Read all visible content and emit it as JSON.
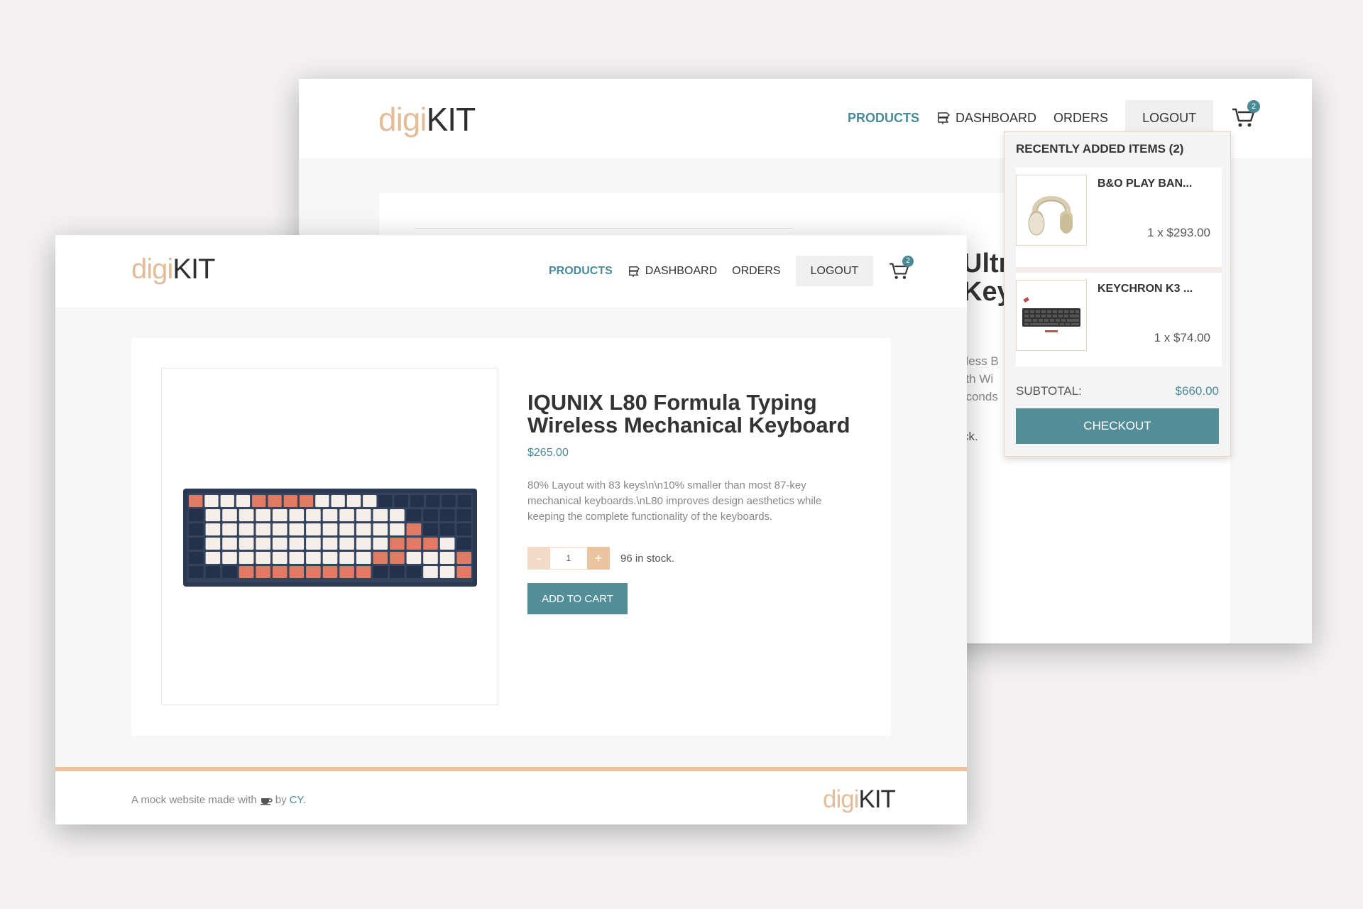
{
  "brand": {
    "digi": "digi",
    "kit": "KIT"
  },
  "nav": {
    "products": "PRODUCTS",
    "dashboard": "DASHBOARD",
    "orders": "ORDERS",
    "logout": "LOGOUT",
    "cart_count": "2"
  },
  "back_page": {
    "title_partial_1": "Ultr",
    "title_partial_2": "Keyb",
    "desc_partial_1": "eless B",
    "desc_partial_2": "oth Wi",
    "desc_partial_3": "econds",
    "stock_partial": "ck."
  },
  "cart_dropdown": {
    "title": "RECENTLY ADDED ITEMS (2)",
    "items": [
      {
        "name": "B&O PLAY BAN...",
        "qty_price": "1 x $293.00",
        "icon": "headphones-image"
      },
      {
        "name": "KEYCHRON K3 ...",
        "qty_price": "1 x $74.00",
        "icon": "keyboard-image"
      }
    ],
    "subtotal_label": "SUBTOTAL:",
    "subtotal_value": "$660.00",
    "checkout": "CHECKOUT"
  },
  "product": {
    "title": "IQUNIX L80 Formula Typing Wireless Mechanical Keyboard",
    "price": "$265.00",
    "description": "80% Layout with 83 keys\\n\\n10% smaller than most 87-key mechanical keyboards.\\nL80 improves design aesthetics while keeping the complete functionality of the keyboards.",
    "qty_minus": "-",
    "qty_value": "1",
    "qty_plus": "+",
    "stock": "96 in stock.",
    "add_to_cart": "ADD TO CART"
  },
  "footer": {
    "credit_prefix": "A mock website made with",
    "credit_by": "by",
    "credit_author": "CY."
  },
  "colors": {
    "accent": "#528d98",
    "brand_peach": "#e3bc98",
    "page_bg": "#f3f1f1"
  }
}
